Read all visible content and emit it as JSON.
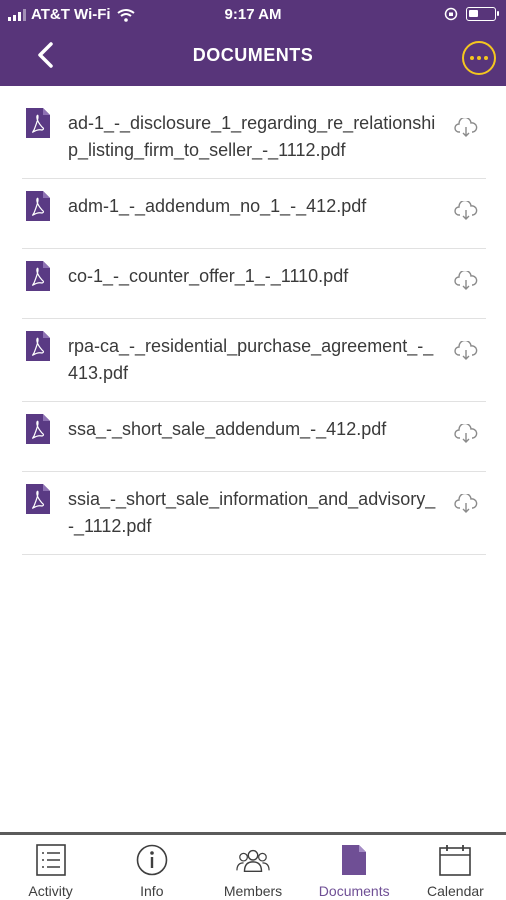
{
  "status_bar": {
    "carrier": "AT&T Wi-Fi",
    "time": "9:17 AM"
  },
  "header": {
    "title": "DOCUMENTS",
    "accent_color": "#f4c61f",
    "background_color": "#58357a"
  },
  "documents": [
    {
      "name": "ad-1_-_disclosure_1_regarding_re_relationship_listing_firm_to_seller_-_1112.pdf"
    },
    {
      "name": "adm-1_-_addendum_no_1_-_412.pdf"
    },
    {
      "name": "co-1_-_counter_offer_1_-_1110.pdf"
    },
    {
      "name": "rpa-ca_-_residential_purchase_agreement_-_413.pdf"
    },
    {
      "name": "ssa_-_short_sale_addendum_-_412.pdf"
    },
    {
      "name": "ssia_-_short_sale_information_and_advisory_-_1112.pdf"
    }
  ],
  "tabs": [
    {
      "label": "Activity",
      "icon": "list-icon"
    },
    {
      "label": "Info",
      "icon": "info-icon"
    },
    {
      "label": "Members",
      "icon": "members-icon"
    },
    {
      "label": "Documents",
      "icon": "document-icon",
      "active": true
    },
    {
      "label": "Calendar",
      "icon": "calendar-icon"
    }
  ]
}
